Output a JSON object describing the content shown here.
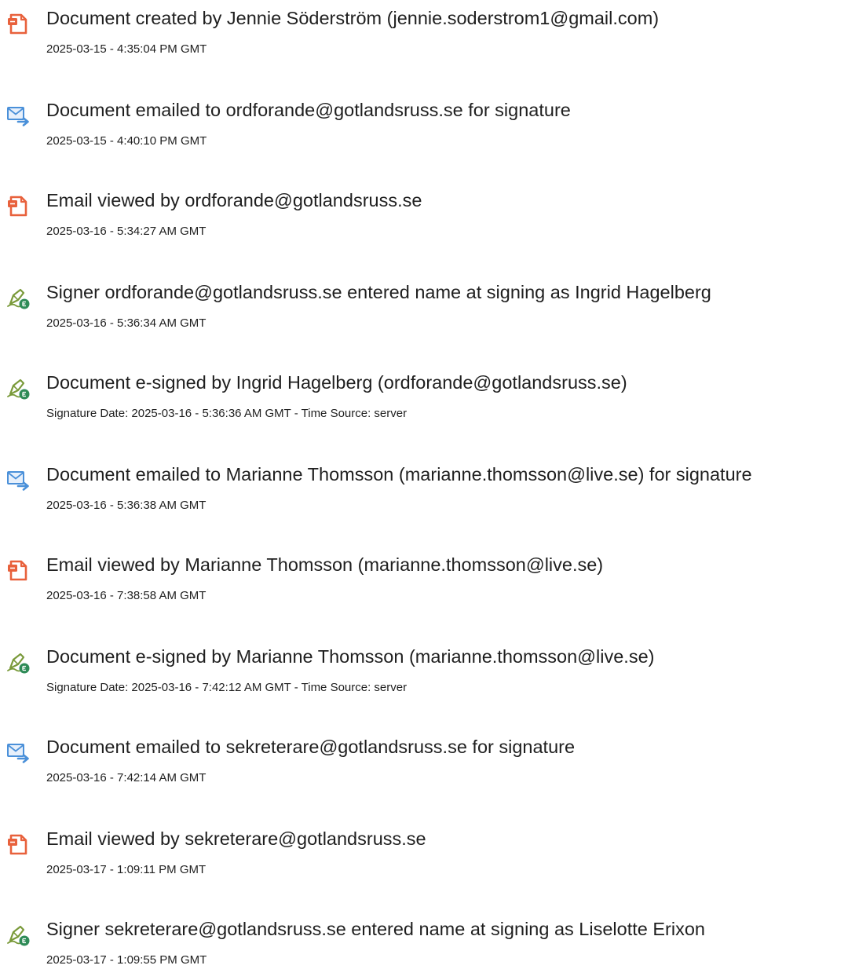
{
  "colors": {
    "text": "#1f1f1f",
    "doc_icon": "#e8613c",
    "mail_icon": "#4a90d9",
    "sign_icon": "#2e8b57"
  },
  "events": [
    {
      "icon": "document-icon",
      "title": "Document created by Jennie Söderström (jennie.soderstrom1@gmail.com)",
      "time": "2025-03-15 - 4:35:04 PM GMT"
    },
    {
      "icon": "email-sent-icon",
      "title": "Document emailed to ordforande@gotlandsruss.se for signature",
      "time": "2025-03-15 - 4:40:10 PM GMT"
    },
    {
      "icon": "document-icon",
      "title": "Email viewed by ordforande@gotlandsruss.se",
      "time": "2025-03-16 - 5:34:27 AM GMT"
    },
    {
      "icon": "signature-pen-icon",
      "title": "Signer ordforande@gotlandsruss.se entered name at signing as Ingrid Hagelberg",
      "time": "2025-03-16 - 5:36:34 AM GMT"
    },
    {
      "icon": "signature-pen-icon",
      "title": "Document e-signed by Ingrid Hagelberg (ordforande@gotlandsruss.se)",
      "time": "Signature Date: 2025-03-16 - 5:36:36 AM GMT - Time Source: server"
    },
    {
      "icon": "email-sent-icon",
      "title": "Document emailed to Marianne Thomsson (marianne.thomsson@live.se) for signature",
      "time": "2025-03-16 - 5:36:38 AM GMT"
    },
    {
      "icon": "document-icon",
      "title": "Email viewed by Marianne Thomsson (marianne.thomsson@live.se)",
      "time": "2025-03-16 - 7:38:58 AM GMT"
    },
    {
      "icon": "signature-pen-icon",
      "title": "Document e-signed by Marianne Thomsson (marianne.thomsson@live.se)",
      "time": "Signature Date: 2025-03-16 - 7:42:12 AM GMT - Time Source: server"
    },
    {
      "icon": "email-sent-icon",
      "title": "Document emailed to sekreterare@gotlandsruss.se for signature",
      "time": "2025-03-16 - 7:42:14 AM GMT"
    },
    {
      "icon": "document-icon",
      "title": "Email viewed by sekreterare@gotlandsruss.se",
      "time": "2025-03-17 - 1:09:11 PM GMT"
    },
    {
      "icon": "signature-pen-icon",
      "title": "Signer sekreterare@gotlandsruss.se entered name at signing as Liselotte Erixon",
      "time": "2025-03-17 - 1:09:55 PM GMT"
    }
  ]
}
